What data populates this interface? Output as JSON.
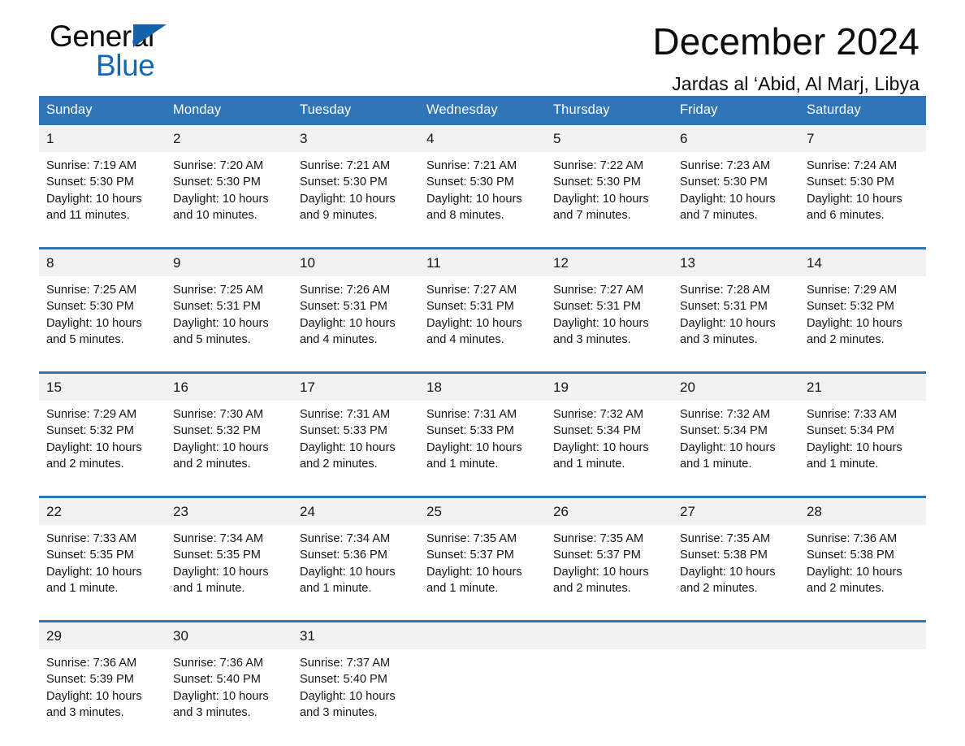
{
  "brand": {
    "name_part1": "General",
    "name_part2": "Blue",
    "triangle_color": "#1463a8",
    "blue_text_color": "#1568b4"
  },
  "header": {
    "title": "December 2024",
    "subtitle": "Jardas al ‘Abid, Al Marj, Libya"
  },
  "theme": {
    "header_blue": "#2f76b8",
    "daynum_band": "#f2f2f2",
    "text": "#161616"
  },
  "weekday_headers": [
    "Sunday",
    "Monday",
    "Tuesday",
    "Wednesday",
    "Thursday",
    "Friday",
    "Saturday"
  ],
  "weeks": [
    {
      "days": [
        {
          "date": "1",
          "sunrise": "Sunrise: 7:19 AM",
          "sunset": "Sunset: 5:30 PM",
          "daylight_line1": "Daylight: 10 hours",
          "daylight_line2": "and 11 minutes."
        },
        {
          "date": "2",
          "sunrise": "Sunrise: 7:20 AM",
          "sunset": "Sunset: 5:30 PM",
          "daylight_line1": "Daylight: 10 hours",
          "daylight_line2": "and 10 minutes."
        },
        {
          "date": "3",
          "sunrise": "Sunrise: 7:21 AM",
          "sunset": "Sunset: 5:30 PM",
          "daylight_line1": "Daylight: 10 hours",
          "daylight_line2": "and 9 minutes."
        },
        {
          "date": "4",
          "sunrise": "Sunrise: 7:21 AM",
          "sunset": "Sunset: 5:30 PM",
          "daylight_line1": "Daylight: 10 hours",
          "daylight_line2": "and 8 minutes."
        },
        {
          "date": "5",
          "sunrise": "Sunrise: 7:22 AM",
          "sunset": "Sunset: 5:30 PM",
          "daylight_line1": "Daylight: 10 hours",
          "daylight_line2": "and 7 minutes."
        },
        {
          "date": "6",
          "sunrise": "Sunrise: 7:23 AM",
          "sunset": "Sunset: 5:30 PM",
          "daylight_line1": "Daylight: 10 hours",
          "daylight_line2": "and 7 minutes."
        },
        {
          "date": "7",
          "sunrise": "Sunrise: 7:24 AM",
          "sunset": "Sunset: 5:30 PM",
          "daylight_line1": "Daylight: 10 hours",
          "daylight_line2": "and 6 minutes."
        }
      ]
    },
    {
      "days": [
        {
          "date": "8",
          "sunrise": "Sunrise: 7:25 AM",
          "sunset": "Sunset: 5:30 PM",
          "daylight_line1": "Daylight: 10 hours",
          "daylight_line2": "and 5 minutes."
        },
        {
          "date": "9",
          "sunrise": "Sunrise: 7:25 AM",
          "sunset": "Sunset: 5:31 PM",
          "daylight_line1": "Daylight: 10 hours",
          "daylight_line2": "and 5 minutes."
        },
        {
          "date": "10",
          "sunrise": "Sunrise: 7:26 AM",
          "sunset": "Sunset: 5:31 PM",
          "daylight_line1": "Daylight: 10 hours",
          "daylight_line2": "and 4 minutes."
        },
        {
          "date": "11",
          "sunrise": "Sunrise: 7:27 AM",
          "sunset": "Sunset: 5:31 PM",
          "daylight_line1": "Daylight: 10 hours",
          "daylight_line2": "and 4 minutes."
        },
        {
          "date": "12",
          "sunrise": "Sunrise: 7:27 AM",
          "sunset": "Sunset: 5:31 PM",
          "daylight_line1": "Daylight: 10 hours",
          "daylight_line2": "and 3 minutes."
        },
        {
          "date": "13",
          "sunrise": "Sunrise: 7:28 AM",
          "sunset": "Sunset: 5:31 PM",
          "daylight_line1": "Daylight: 10 hours",
          "daylight_line2": "and 3 minutes."
        },
        {
          "date": "14",
          "sunrise": "Sunrise: 7:29 AM",
          "sunset": "Sunset: 5:32 PM",
          "daylight_line1": "Daylight: 10 hours",
          "daylight_line2": "and 2 minutes."
        }
      ]
    },
    {
      "days": [
        {
          "date": "15",
          "sunrise": "Sunrise: 7:29 AM",
          "sunset": "Sunset: 5:32 PM",
          "daylight_line1": "Daylight: 10 hours",
          "daylight_line2": "and 2 minutes."
        },
        {
          "date": "16",
          "sunrise": "Sunrise: 7:30 AM",
          "sunset": "Sunset: 5:32 PM",
          "daylight_line1": "Daylight: 10 hours",
          "daylight_line2": "and 2 minutes."
        },
        {
          "date": "17",
          "sunrise": "Sunrise: 7:31 AM",
          "sunset": "Sunset: 5:33 PM",
          "daylight_line1": "Daylight: 10 hours",
          "daylight_line2": "and 2 minutes."
        },
        {
          "date": "18",
          "sunrise": "Sunrise: 7:31 AM",
          "sunset": "Sunset: 5:33 PM",
          "daylight_line1": "Daylight: 10 hours",
          "daylight_line2": "and 1 minute."
        },
        {
          "date": "19",
          "sunrise": "Sunrise: 7:32 AM",
          "sunset": "Sunset: 5:34 PM",
          "daylight_line1": "Daylight: 10 hours",
          "daylight_line2": "and 1 minute."
        },
        {
          "date": "20",
          "sunrise": "Sunrise: 7:32 AM",
          "sunset": "Sunset: 5:34 PM",
          "daylight_line1": "Daylight: 10 hours",
          "daylight_line2": "and 1 minute."
        },
        {
          "date": "21",
          "sunrise": "Sunrise: 7:33 AM",
          "sunset": "Sunset: 5:34 PM",
          "daylight_line1": "Daylight: 10 hours",
          "daylight_line2": "and 1 minute."
        }
      ]
    },
    {
      "days": [
        {
          "date": "22",
          "sunrise": "Sunrise: 7:33 AM",
          "sunset": "Sunset: 5:35 PM",
          "daylight_line1": "Daylight: 10 hours",
          "daylight_line2": "and 1 minute."
        },
        {
          "date": "23",
          "sunrise": "Sunrise: 7:34 AM",
          "sunset": "Sunset: 5:35 PM",
          "daylight_line1": "Daylight: 10 hours",
          "daylight_line2": "and 1 minute."
        },
        {
          "date": "24",
          "sunrise": "Sunrise: 7:34 AM",
          "sunset": "Sunset: 5:36 PM",
          "daylight_line1": "Daylight: 10 hours",
          "daylight_line2": "and 1 minute."
        },
        {
          "date": "25",
          "sunrise": "Sunrise: 7:35 AM",
          "sunset": "Sunset: 5:37 PM",
          "daylight_line1": "Daylight: 10 hours",
          "daylight_line2": "and 1 minute."
        },
        {
          "date": "26",
          "sunrise": "Sunrise: 7:35 AM",
          "sunset": "Sunset: 5:37 PM",
          "daylight_line1": "Daylight: 10 hours",
          "daylight_line2": "and 2 minutes."
        },
        {
          "date": "27",
          "sunrise": "Sunrise: 7:35 AM",
          "sunset": "Sunset: 5:38 PM",
          "daylight_line1": "Daylight: 10 hours",
          "daylight_line2": "and 2 minutes."
        },
        {
          "date": "28",
          "sunrise": "Sunrise: 7:36 AM",
          "sunset": "Sunset: 5:38 PM",
          "daylight_line1": "Daylight: 10 hours",
          "daylight_line2": "and 2 minutes."
        }
      ]
    },
    {
      "days": [
        {
          "date": "29",
          "sunrise": "Sunrise: 7:36 AM",
          "sunset": "Sunset: 5:39 PM",
          "daylight_line1": "Daylight: 10 hours",
          "daylight_line2": "and 3 minutes."
        },
        {
          "date": "30",
          "sunrise": "Sunrise: 7:36 AM",
          "sunset": "Sunset: 5:40 PM",
          "daylight_line1": "Daylight: 10 hours",
          "daylight_line2": "and 3 minutes."
        },
        {
          "date": "31",
          "sunrise": "Sunrise: 7:37 AM",
          "sunset": "Sunset: 5:40 PM",
          "daylight_line1": "Daylight: 10 hours",
          "daylight_line2": "and 3 minutes."
        },
        {
          "date": "",
          "sunrise": "",
          "sunset": "",
          "daylight_line1": "",
          "daylight_line2": ""
        },
        {
          "date": "",
          "sunrise": "",
          "sunset": "",
          "daylight_line1": "",
          "daylight_line2": ""
        },
        {
          "date": "",
          "sunrise": "",
          "sunset": "",
          "daylight_line1": "",
          "daylight_line2": ""
        },
        {
          "date": "",
          "sunrise": "",
          "sunset": "",
          "daylight_line1": "",
          "daylight_line2": ""
        }
      ]
    }
  ]
}
